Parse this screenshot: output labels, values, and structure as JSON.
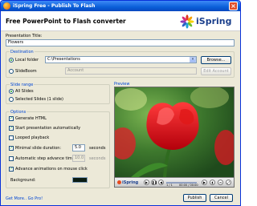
{
  "window": {
    "title": "iSpring Free - Publish To Flash"
  },
  "header": {
    "title": "Free PowerPoint to Flash converter",
    "logo_text": "iSpring"
  },
  "presentation": {
    "label": "Presentation Title:",
    "value": "Flowers"
  },
  "destination": {
    "group_label": "Destination",
    "local_folder_label": "Local folder",
    "local_folder_value": "C:\\Presentations",
    "browse_label": "Browse...",
    "slideboom_label": "SlideBoom",
    "account_placeholder": "Account",
    "edit_account_label": "Edit Account"
  },
  "slide_range": {
    "group_label": "Slide range",
    "all_slides": "All Slides",
    "selected_slides": "Selected Slides (1 slide)"
  },
  "options": {
    "group_label": "Options",
    "generate_html": "Generate HTML",
    "start_auto": "Start presentation automatically",
    "looped": "Looped playback",
    "min_duration_label": "Minimal slide duration:",
    "min_duration_value": "5.0",
    "min_duration_unit": "seconds",
    "auto_step_label": "Automatic step advance time:",
    "auto_step_value": "10.0",
    "auto_step_unit": "seconds",
    "advance_anim": "Advance animations on mouse click",
    "background_label": "Background:",
    "background_color": "#0b1c12"
  },
  "preview": {
    "label": "Preview",
    "player_logo": "iSpring",
    "slide_counter": "1 / 1",
    "time": "00:00 / 00:00"
  },
  "footer": {
    "link": "Get More.. Go Pro!",
    "publish_label": "Publish",
    "cancel_label": "Cancel"
  },
  "colors": {
    "accent": "#0046d5",
    "titlebar": "#0a5fd8",
    "logo": "#1b3f8c"
  }
}
